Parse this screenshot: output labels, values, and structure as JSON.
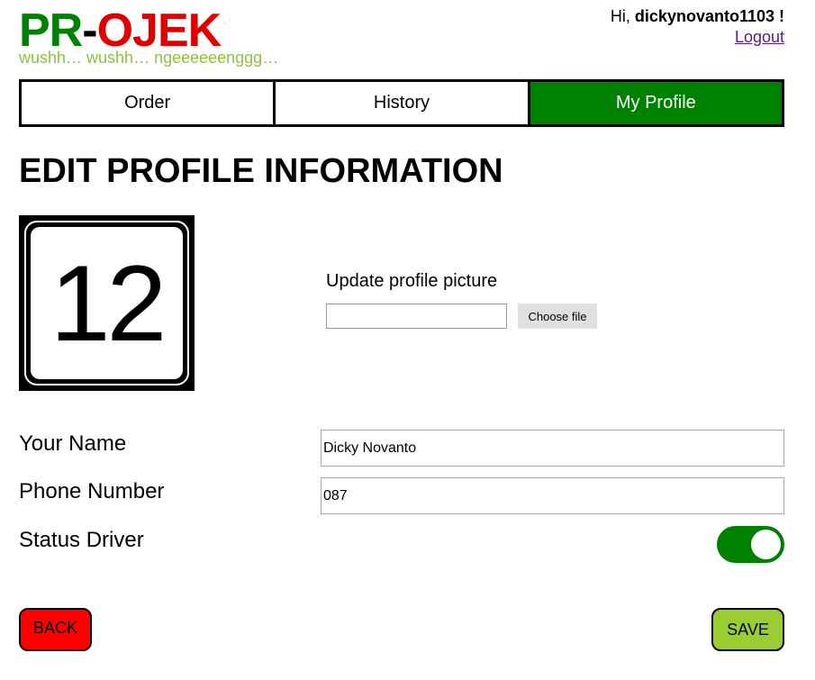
{
  "header": {
    "logo_part1": "PR",
    "logo_dash": "-",
    "logo_part2": "OJEK",
    "tagline": "wushh… wushh… ngeeeeeenggg…",
    "greeting_prefix": "Hi, ",
    "username": "dickynovanto1103",
    "greeting_suffix": " !",
    "logout_label": "Logout"
  },
  "nav": {
    "tabs": [
      {
        "label": "Order",
        "active": false
      },
      {
        "label": "History",
        "active": false
      },
      {
        "label": "My Profile",
        "active": true
      }
    ]
  },
  "page_title": "EDIT PROFILE INFORMATION",
  "profile_picture": {
    "image_text": "12",
    "update_label": "Update profile picture",
    "choose_file_label": "Choose file"
  },
  "form": {
    "name_label": "Your Name",
    "name_value": "Dicky Novanto",
    "phone_label": "Phone Number",
    "phone_value": "087",
    "status_label": "Status Driver",
    "status_driver_on": true
  },
  "buttons": {
    "back_label": "BACK",
    "save_label": "SAVE"
  },
  "colors": {
    "brand_green": "#008000",
    "brand_red": "#e00000",
    "tagline_green": "#8fc23a",
    "back_red": "#ff0000",
    "save_green": "#9acd32"
  }
}
